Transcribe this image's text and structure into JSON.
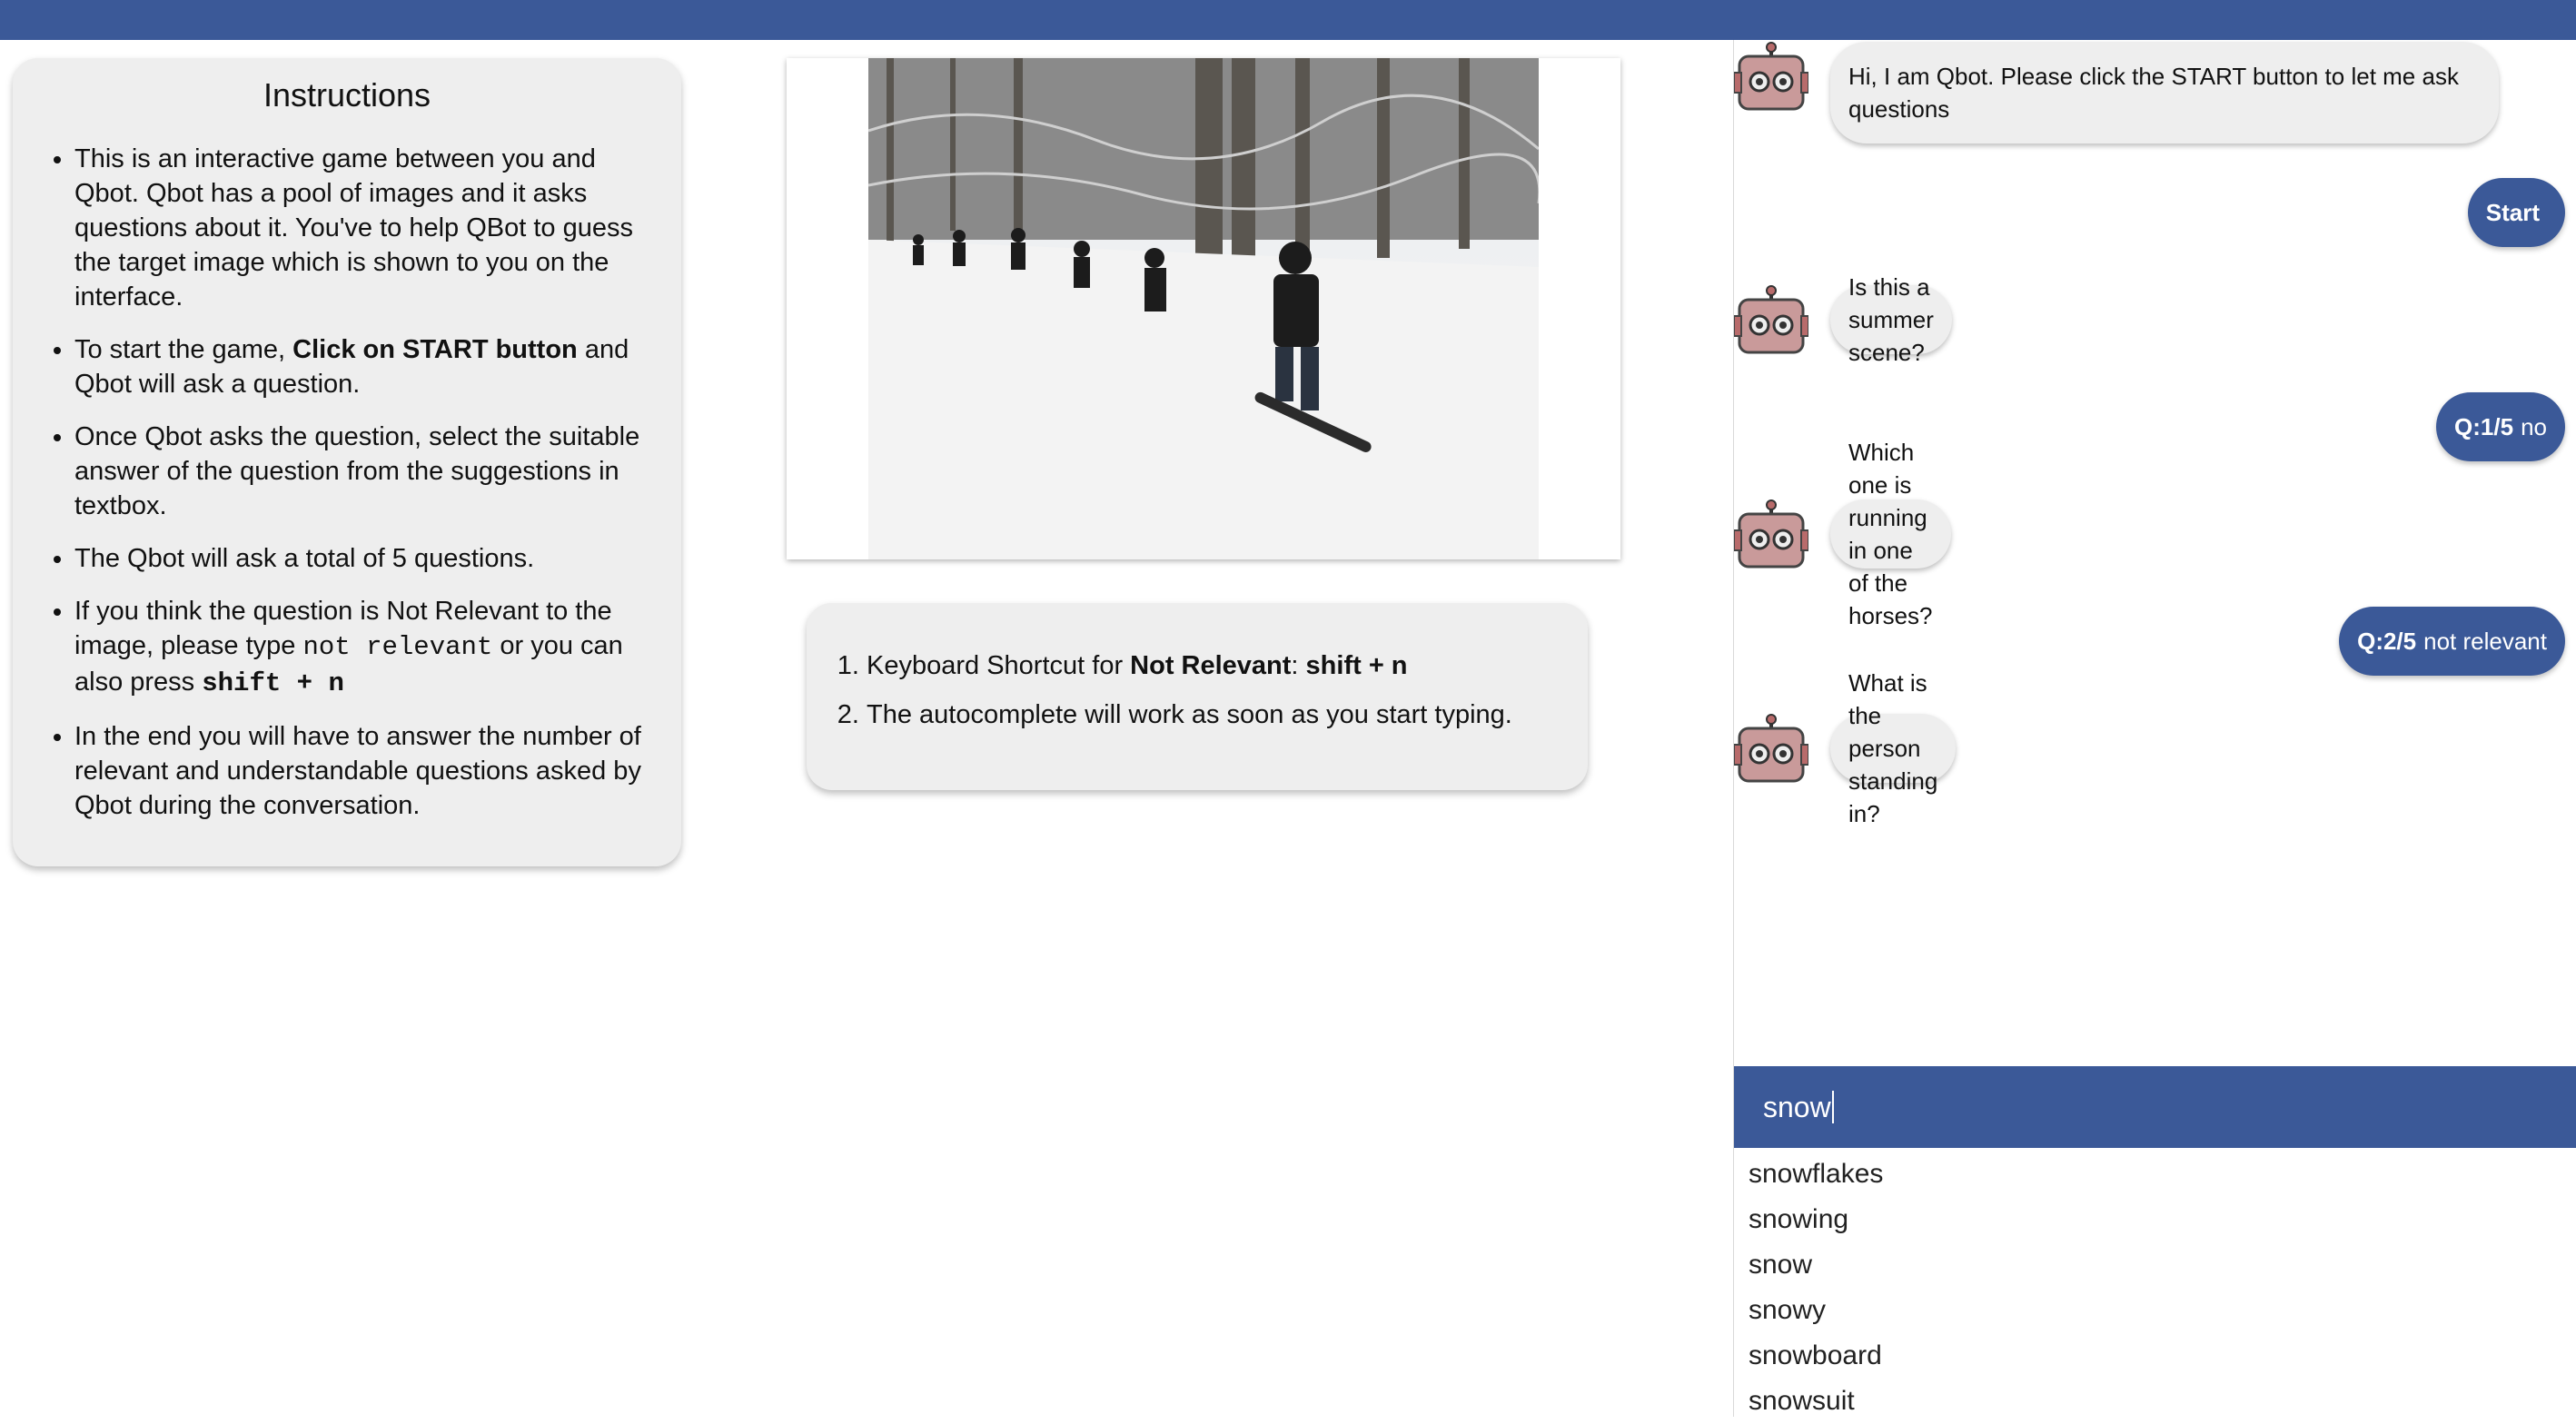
{
  "instructions": {
    "title": "Instructions",
    "items": [
      {
        "text": "This is an interactive game between you and Qbot. Qbot has a pool of images and it asks questions about it. You've to help QBot to guess the target image which is shown to you on the interface."
      },
      {
        "pre": "To start the game, ",
        "bold": "Click on START button",
        "post": " and Qbot will ask a question."
      },
      {
        "text": "Once Qbot asks the question, select the suitable answer of the question from the suggestions in textbox."
      },
      {
        "text": "The Qbot will ask a total of 5 questions."
      },
      {
        "pre": "If you think the question is Not Relevant to the image, please type ",
        "code1": "not relevant",
        "mid": " or you can also press ",
        "code2": "shift + n"
      },
      {
        "text": "In the end you will have to answer the number of relevant and understandable questions asked by Qbot during the conversation."
      }
    ]
  },
  "tips": [
    {
      "pre": "Keyboard Shortcut for ",
      "bold": "Not Relevant",
      "mid": ": ",
      "bold2": "shift + n"
    },
    {
      "text": "The autocomplete will work as soon as you start typing."
    }
  ],
  "chat": {
    "bot_messages": [
      "Hi, I am Qbot. Please click the START button to let me ask questions",
      "Is this a summer scene?",
      "Which one is running in one of the horses?",
      "What is the person standing in?"
    ],
    "user_messages": [
      {
        "label": "",
        "text": "Start"
      },
      {
        "label": "Q:1/5",
        "text": "no"
      },
      {
        "label": "Q:2/5",
        "text": "not relevant"
      }
    ],
    "input_value": "snow",
    "suggestions": [
      "snowflakes",
      "snowing",
      "snow",
      "snowy",
      "snowboard",
      "snowsuit"
    ]
  },
  "colors": {
    "accent": "#3b5998",
    "card": "#eeeeee"
  }
}
